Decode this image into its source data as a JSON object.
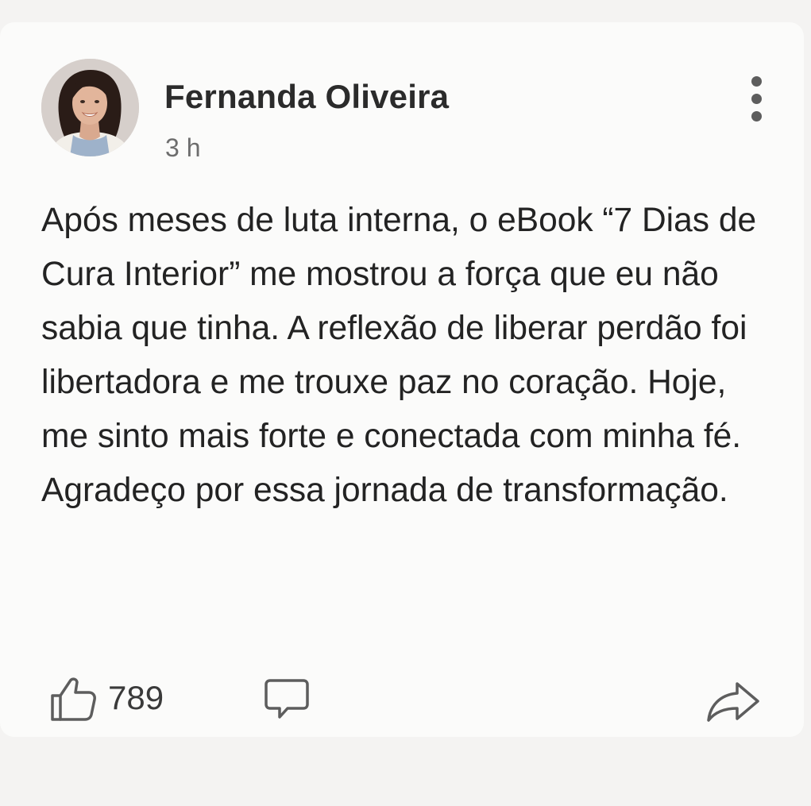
{
  "post": {
    "author_name": "Fernanda Oliveira",
    "timestamp": "3 h",
    "text": "Após meses de luta interna, o eBook “7 Dias de Cura Interior” me mostrou a força que eu não sabia que tinha. A reflexão de liberar perdão foi libertadora e me trouxe paz no coração. Hoje, me sinto mais forte e conectada com minha fé. Agradeço por essa jornada de transformação.",
    "like_count": "789"
  },
  "icons": {
    "avatar": "profile-photo",
    "more": "more-vertical-icon",
    "like": "thumbs-up-icon",
    "comment": "comment-icon",
    "share": "share-arrow-icon"
  },
  "colors": {
    "card_background": "#fbfbfa",
    "page_background": "#f4f3f2",
    "text": "#232323",
    "muted_text": "#6d6d6d",
    "icon": "#5d5d5d"
  }
}
